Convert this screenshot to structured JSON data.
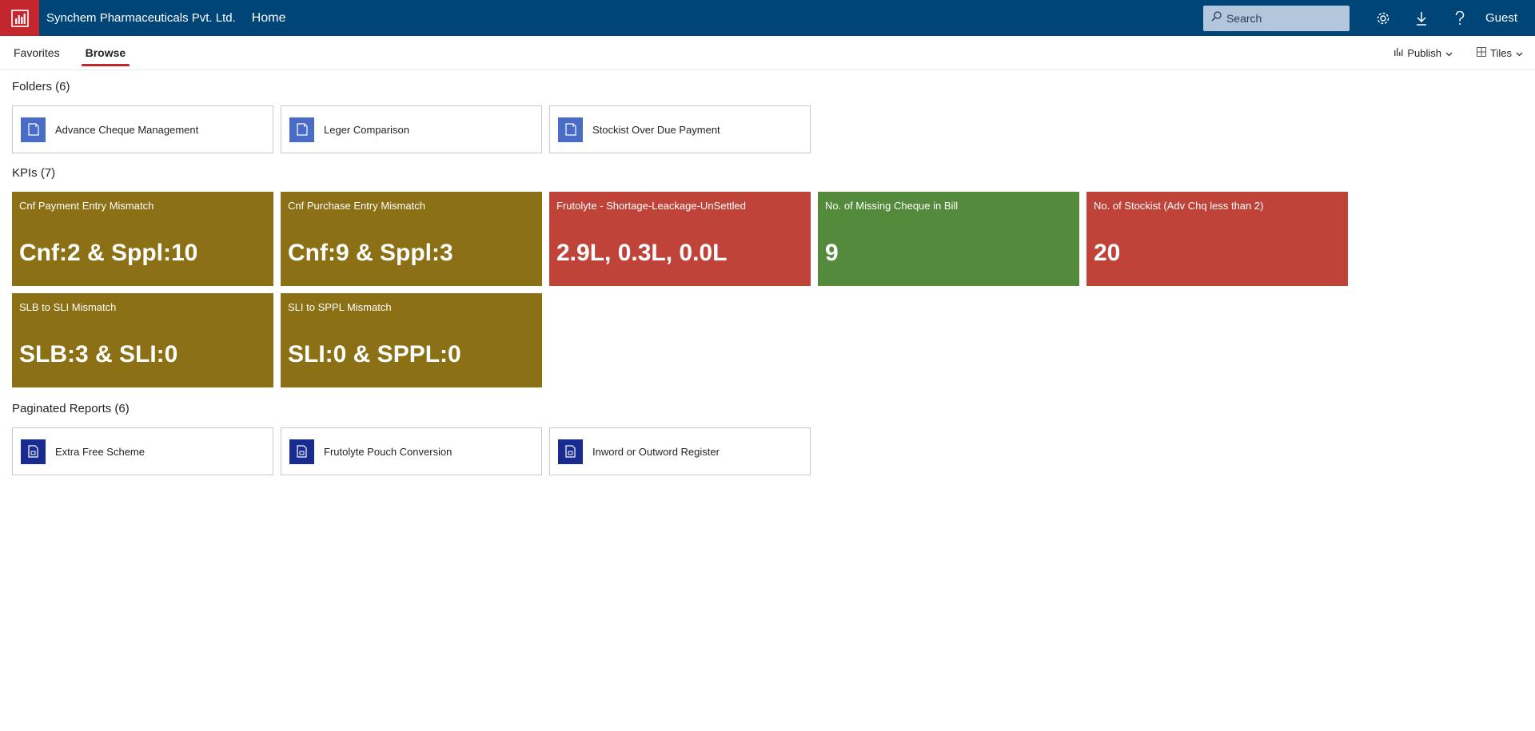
{
  "header": {
    "org_name": "Synchem Pharmaceuticals Pvt. Ltd.",
    "home_label": "Home",
    "search_placeholder": "Search",
    "user_label": "Guest",
    "icons": [
      "report-logo-icon",
      "search-icon",
      "gear-icon",
      "download-icon",
      "help-icon"
    ]
  },
  "subnav": {
    "tabs": [
      {
        "label": "Favorites",
        "active": false
      },
      {
        "label": "Browse",
        "active": true
      }
    ],
    "publish_label": "Publish",
    "view_label": "Tiles"
  },
  "folders": {
    "title": "Folders (6)",
    "items": [
      {
        "label": "Advance Cheque Management"
      },
      {
        "label": "Leger Comparison"
      },
      {
        "label": "Stockist Over Due Payment"
      }
    ]
  },
  "kpis": {
    "title": "KPIs (7)",
    "items": [
      {
        "name": "Cnf Payment Entry Mismatch",
        "value": "Cnf:2 & Sppl:10",
        "color": "#8c7015"
      },
      {
        "name": "Cnf Purchase Entry Mismatch",
        "value": "Cnf:9 & Sppl:3",
        "color": "#8c7015"
      },
      {
        "name": "Frutolyte - Shortage-Leackage-UnSettled",
        "value": "2.9L, 0.3L, 0.0L",
        "color": "#c0433a"
      },
      {
        "name": "No. of Missing Cheque in Bill",
        "value": "9",
        "color": "#548a3b"
      },
      {
        "name": "No. of Stockist (Adv Chq less than 2)",
        "value": "20",
        "color": "#c0433a"
      },
      {
        "name": "SLB to SLI Mismatch",
        "value": "SLB:3 & SLI:0",
        "color": "#8c7015"
      },
      {
        "name": "SLI to SPPL Mismatch",
        "value": "SLI:0 & SPPL:0",
        "color": "#8c7015"
      }
    ]
  },
  "reports": {
    "title": "Paginated Reports (6)",
    "items": [
      {
        "label": "Extra Free Scheme"
      },
      {
        "label": "Frutolyte Pouch Conversion"
      },
      {
        "label": "Inword or Outword Register"
      }
    ]
  }
}
